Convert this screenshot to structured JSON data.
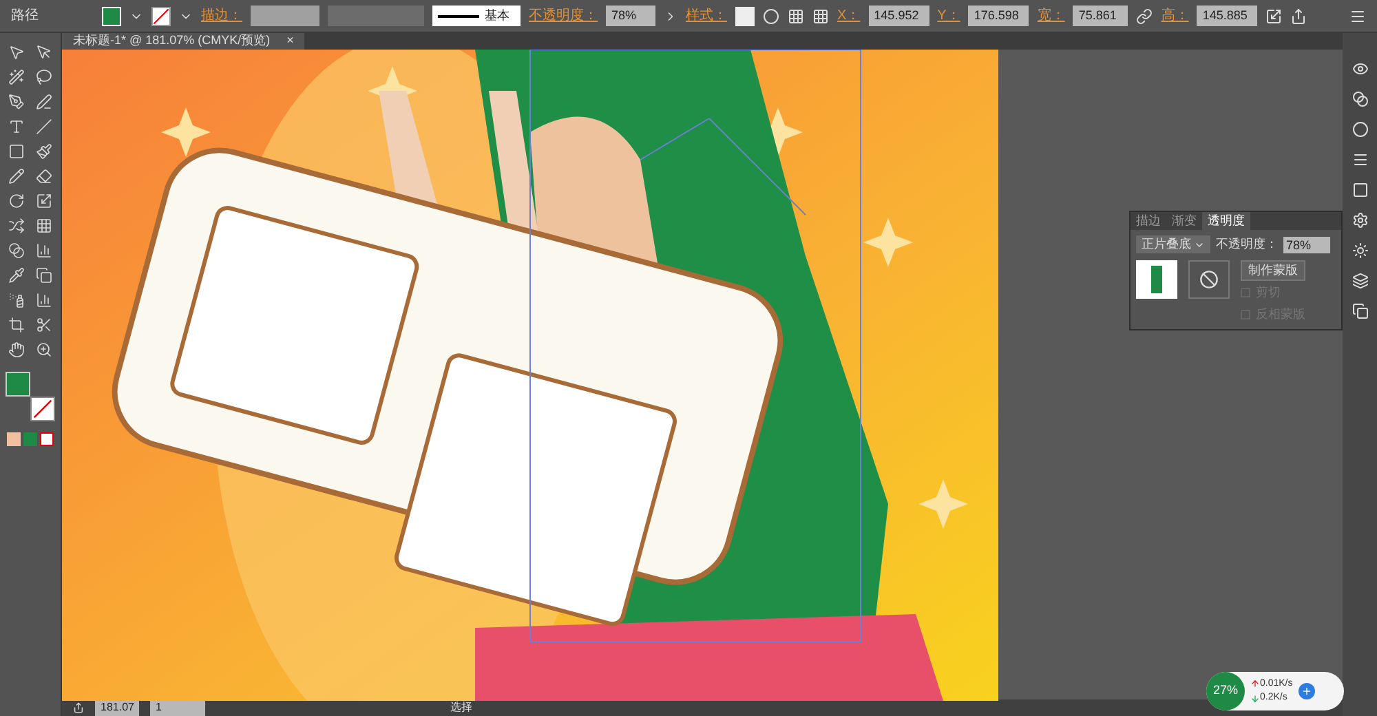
{
  "control_bar": {
    "selection_label": "路径",
    "stroke_label": "描边：",
    "stroke_style": "基本",
    "opacity_label": "不透明度：",
    "opacity_value": "78%",
    "style_label": "样式：",
    "x_label": "X：",
    "x_value": "145.952",
    "y_label": "Y：",
    "y_value": "176.598",
    "w_label": "宽：",
    "w_value": "75.861",
    "h_label": "高：",
    "h_value": "145.885"
  },
  "document_tab": {
    "title": "未标题-1* @ 181.07% (CMYK/预览)",
    "close": "×"
  },
  "transparency_panel": {
    "tabs": [
      {
        "label": "描边",
        "selected": false
      },
      {
        "label": "渐变",
        "selected": false
      },
      {
        "label": "透明度",
        "selected": true
      }
    ],
    "blend_mode": "正片叠底",
    "opacity_label": "不透明度：",
    "opacity_value": "78%",
    "make_mask": "制作蒙版",
    "options": [
      {
        "label": "剪切",
        "checked": false,
        "disabled": true
      },
      {
        "label": "反相蒙版",
        "checked": false,
        "disabled": true
      }
    ]
  },
  "status_bar": {
    "zoom": "181.07",
    "artboard": "1",
    "tool": "选择"
  },
  "network_widget": {
    "percent": "27%",
    "upload": "0.01K/s",
    "download": "0.2K/s"
  }
}
